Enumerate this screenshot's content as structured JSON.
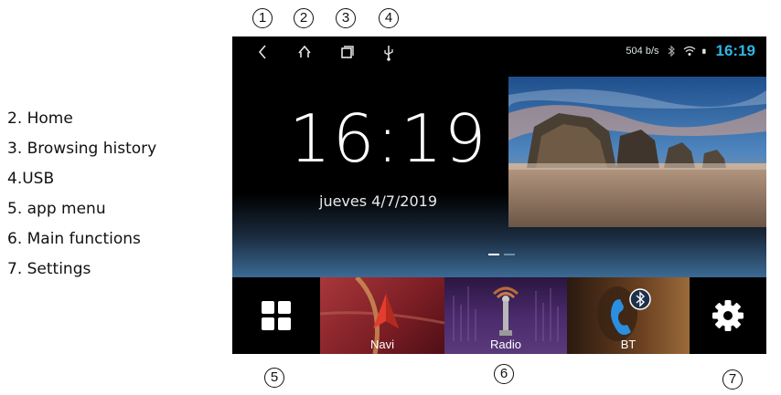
{
  "callouts": {
    "c1": "1",
    "c2": "2",
    "c3": "3",
    "c4": "4",
    "c5": "5",
    "c6": "6",
    "c7": "7"
  },
  "legend": {
    "items": [
      "2. Home",
      "3. Browsing history",
      "4.USB",
      "5. app menu",
      "6. Main functions",
      "7. Settings"
    ]
  },
  "statusbar": {
    "nav_icons": [
      "back-icon",
      "home-icon",
      "recent-apps-icon",
      "usb-icon"
    ],
    "data_rate": "504 b/s",
    "time": "16:19",
    "status_icons": [
      "bluetooth-icon",
      "wifi-icon",
      "battery-icon"
    ],
    "accent_color": "#2fb7e6"
  },
  "main": {
    "clock": "16:19",
    "date": "jueves 4/7/2019",
    "pager_pages": 2,
    "pager_active": 1
  },
  "dock": {
    "app_menu_icon": "grid-icon",
    "tiles": [
      {
        "label": "Navi",
        "icon": "navigation-arrow-icon"
      },
      {
        "label": "Radio",
        "icon": "antenna-icon"
      },
      {
        "label": "BT",
        "icon": "bluetooth-phone-icon"
      }
    ],
    "settings_icon": "gear-icon"
  }
}
